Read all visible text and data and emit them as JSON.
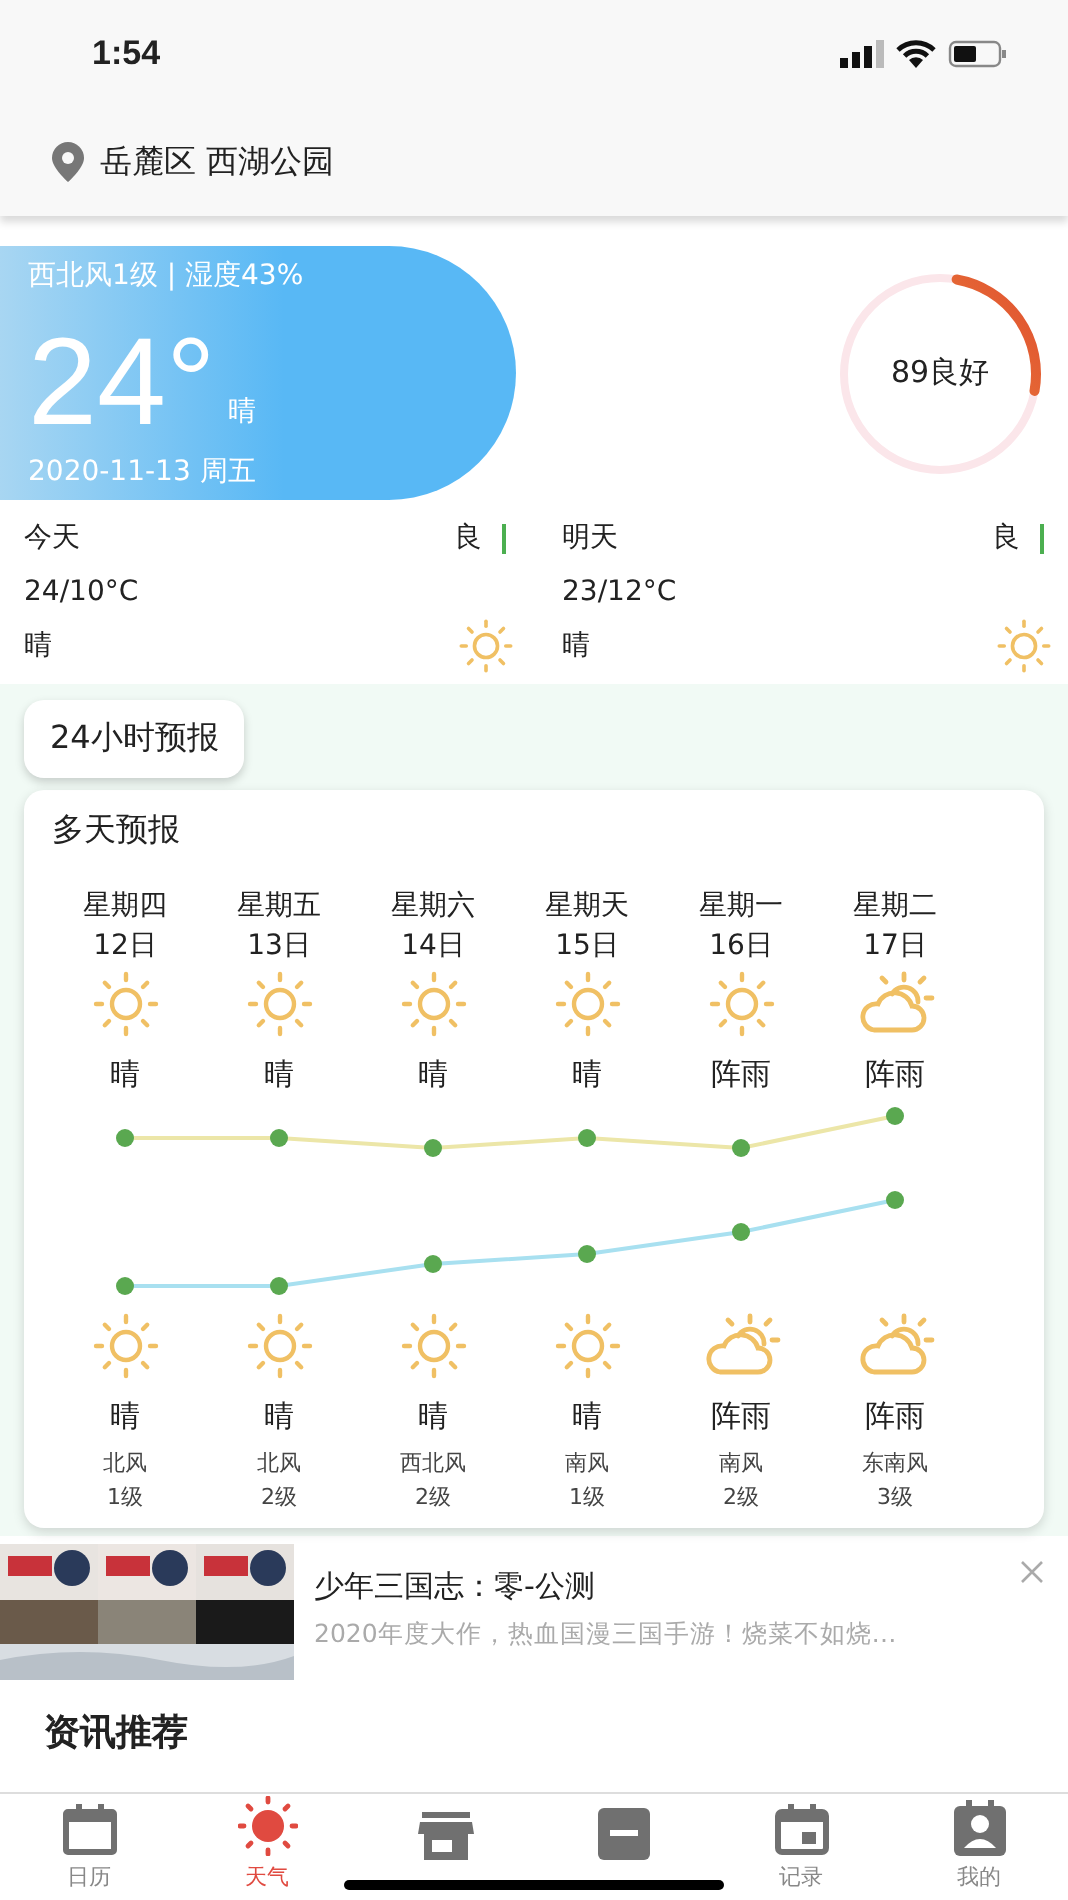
{
  "status_bar": {
    "time": "1:54"
  },
  "location": {
    "text": "岳麓区 西湖公园"
  },
  "current": {
    "wind_humidity": "西北风1级 | 湿度43%",
    "temperature": "24°",
    "condition": "晴",
    "date": "2020-11-13 周五"
  },
  "air_quality": {
    "reading": "89良好",
    "level": 0.25
  },
  "summary": [
    {
      "day": "今天",
      "quality": "良",
      "range": "24/10°C",
      "condition": "晴"
    },
    {
      "day": "明天",
      "quality": "良",
      "range": "23/12°C",
      "condition": "晴"
    }
  ],
  "hourly_button": {
    "label": "24小时预报"
  },
  "forecast": {
    "title": "多天预报",
    "days": [
      {
        "weekday": "星期四",
        "date": "12日",
        "day": {
          "kind": "sun",
          "condition": "晴"
        },
        "night": {
          "kind": "sun",
          "condition": "晴"
        },
        "wind": "北风",
        "wind_level": "1级"
      },
      {
        "weekday": "星期五",
        "date": "13日",
        "day": {
          "kind": "sun",
          "condition": "晴"
        },
        "night": {
          "kind": "sun",
          "condition": "晴"
        },
        "wind": "北风",
        "wind_level": "2级"
      },
      {
        "weekday": "星期六",
        "date": "14日",
        "day": {
          "kind": "sun",
          "condition": "晴"
        },
        "night": {
          "kind": "sun",
          "condition": "晴"
        },
        "wind": "西北风",
        "wind_level": "2级"
      },
      {
        "weekday": "星期天",
        "date": "15日",
        "day": {
          "kind": "sun",
          "condition": "晴"
        },
        "night": {
          "kind": "sun",
          "condition": "晴"
        },
        "wind": "南风",
        "wind_level": "1级"
      },
      {
        "weekday": "星期一",
        "date": "16日",
        "day": {
          "kind": "sun",
          "condition": "阵雨"
        },
        "night": {
          "kind": "cloudy",
          "condition": "阵雨"
        },
        "wind": "南风",
        "wind_level": "2级"
      },
      {
        "weekday": "星期二",
        "date": "17日",
        "day": {
          "kind": "cloudy",
          "condition": "阵雨"
        },
        "night": {
          "kind": "cloudy",
          "condition": "阵雨"
        },
        "wind": "东南风",
        "wind_level": "3级"
      }
    ]
  },
  "ad": {
    "title": "少年三国志：零-公测",
    "description": "2020年度大作，热血国漫三国手游！烧菜不如烧…"
  },
  "news": {
    "title": "资讯推荐"
  },
  "tabs": [
    {
      "label": "日历",
      "selected": false
    },
    {
      "label": "天气",
      "selected": true
    },
    {
      "selected": false
    },
    {
      "selected": false
    },
    {
      "label": "记录",
      "selected": false
    },
    {
      "label": "我的",
      "selected": false
    }
  ]
}
